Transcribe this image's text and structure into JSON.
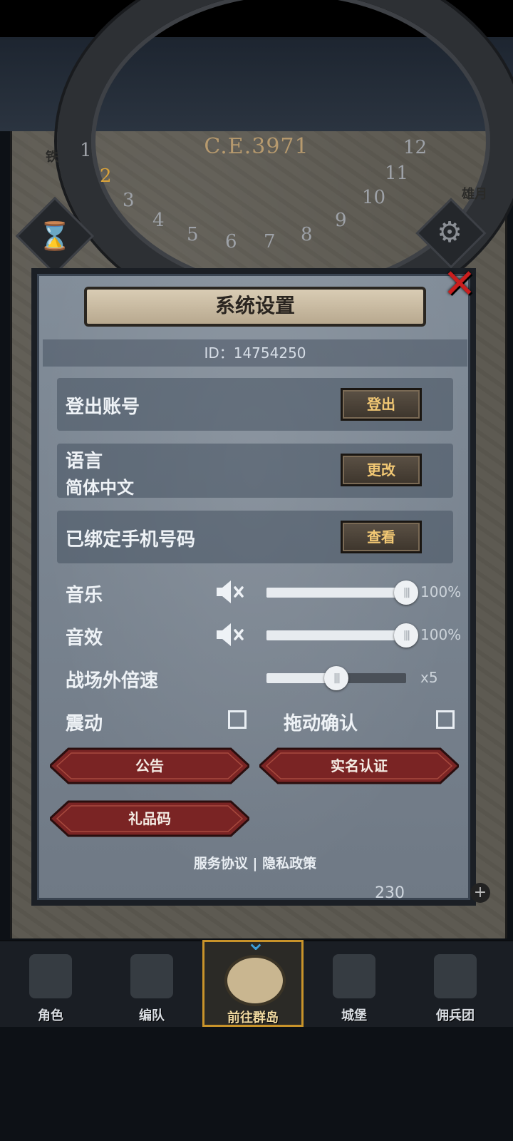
{
  "world": {
    "era": "C.E.3971",
    "left_label": "铁",
    "right_label": "雄月",
    "months": [
      "1",
      "2",
      "3",
      "4",
      "5",
      "6",
      "7",
      "8",
      "9",
      "10",
      "11",
      "12"
    ],
    "currency_amount": "230"
  },
  "dialog": {
    "title": "系统设置",
    "close_icon": "close-x-icon",
    "id_text": "ID：14754250",
    "account": {
      "label": "登出账号",
      "button": "登出"
    },
    "language": {
      "label": "语言",
      "value": "简体中文",
      "button": "更改"
    },
    "phone": {
      "label": "已绑定手机号码",
      "button": "查看"
    },
    "music": {
      "label": "音乐",
      "percent_text": "100%",
      "level": 1.0,
      "icon": "mute-speaker-icon"
    },
    "sound": {
      "label": "音效",
      "percent_text": "100%",
      "level": 1.0,
      "icon": "mute-speaker-icon"
    },
    "speed": {
      "label": "战场外倍速",
      "value_text": "x5",
      "level": 0.5
    },
    "vibrate": {
      "label": "震动",
      "checked": false
    },
    "drag_confirm": {
      "label": "拖动确认",
      "checked": false
    },
    "buttons": {
      "notice": "公告",
      "realname": "实名认证",
      "gift": "礼品码"
    },
    "links": {
      "service": "服务协议",
      "separator": "|",
      "privacy": "隐私政策"
    }
  },
  "nav": {
    "items": [
      {
        "label": "角色",
        "icon": "knight-icon"
      },
      {
        "label": "编队",
        "icon": "formation-icon"
      },
      {
        "label": "前往群岛",
        "icon": "globe-icon",
        "active": true
      },
      {
        "label": "城堡",
        "icon": "castle-icon"
      },
      {
        "label": "佣兵团",
        "icon": "mercenary-icon"
      }
    ]
  }
}
